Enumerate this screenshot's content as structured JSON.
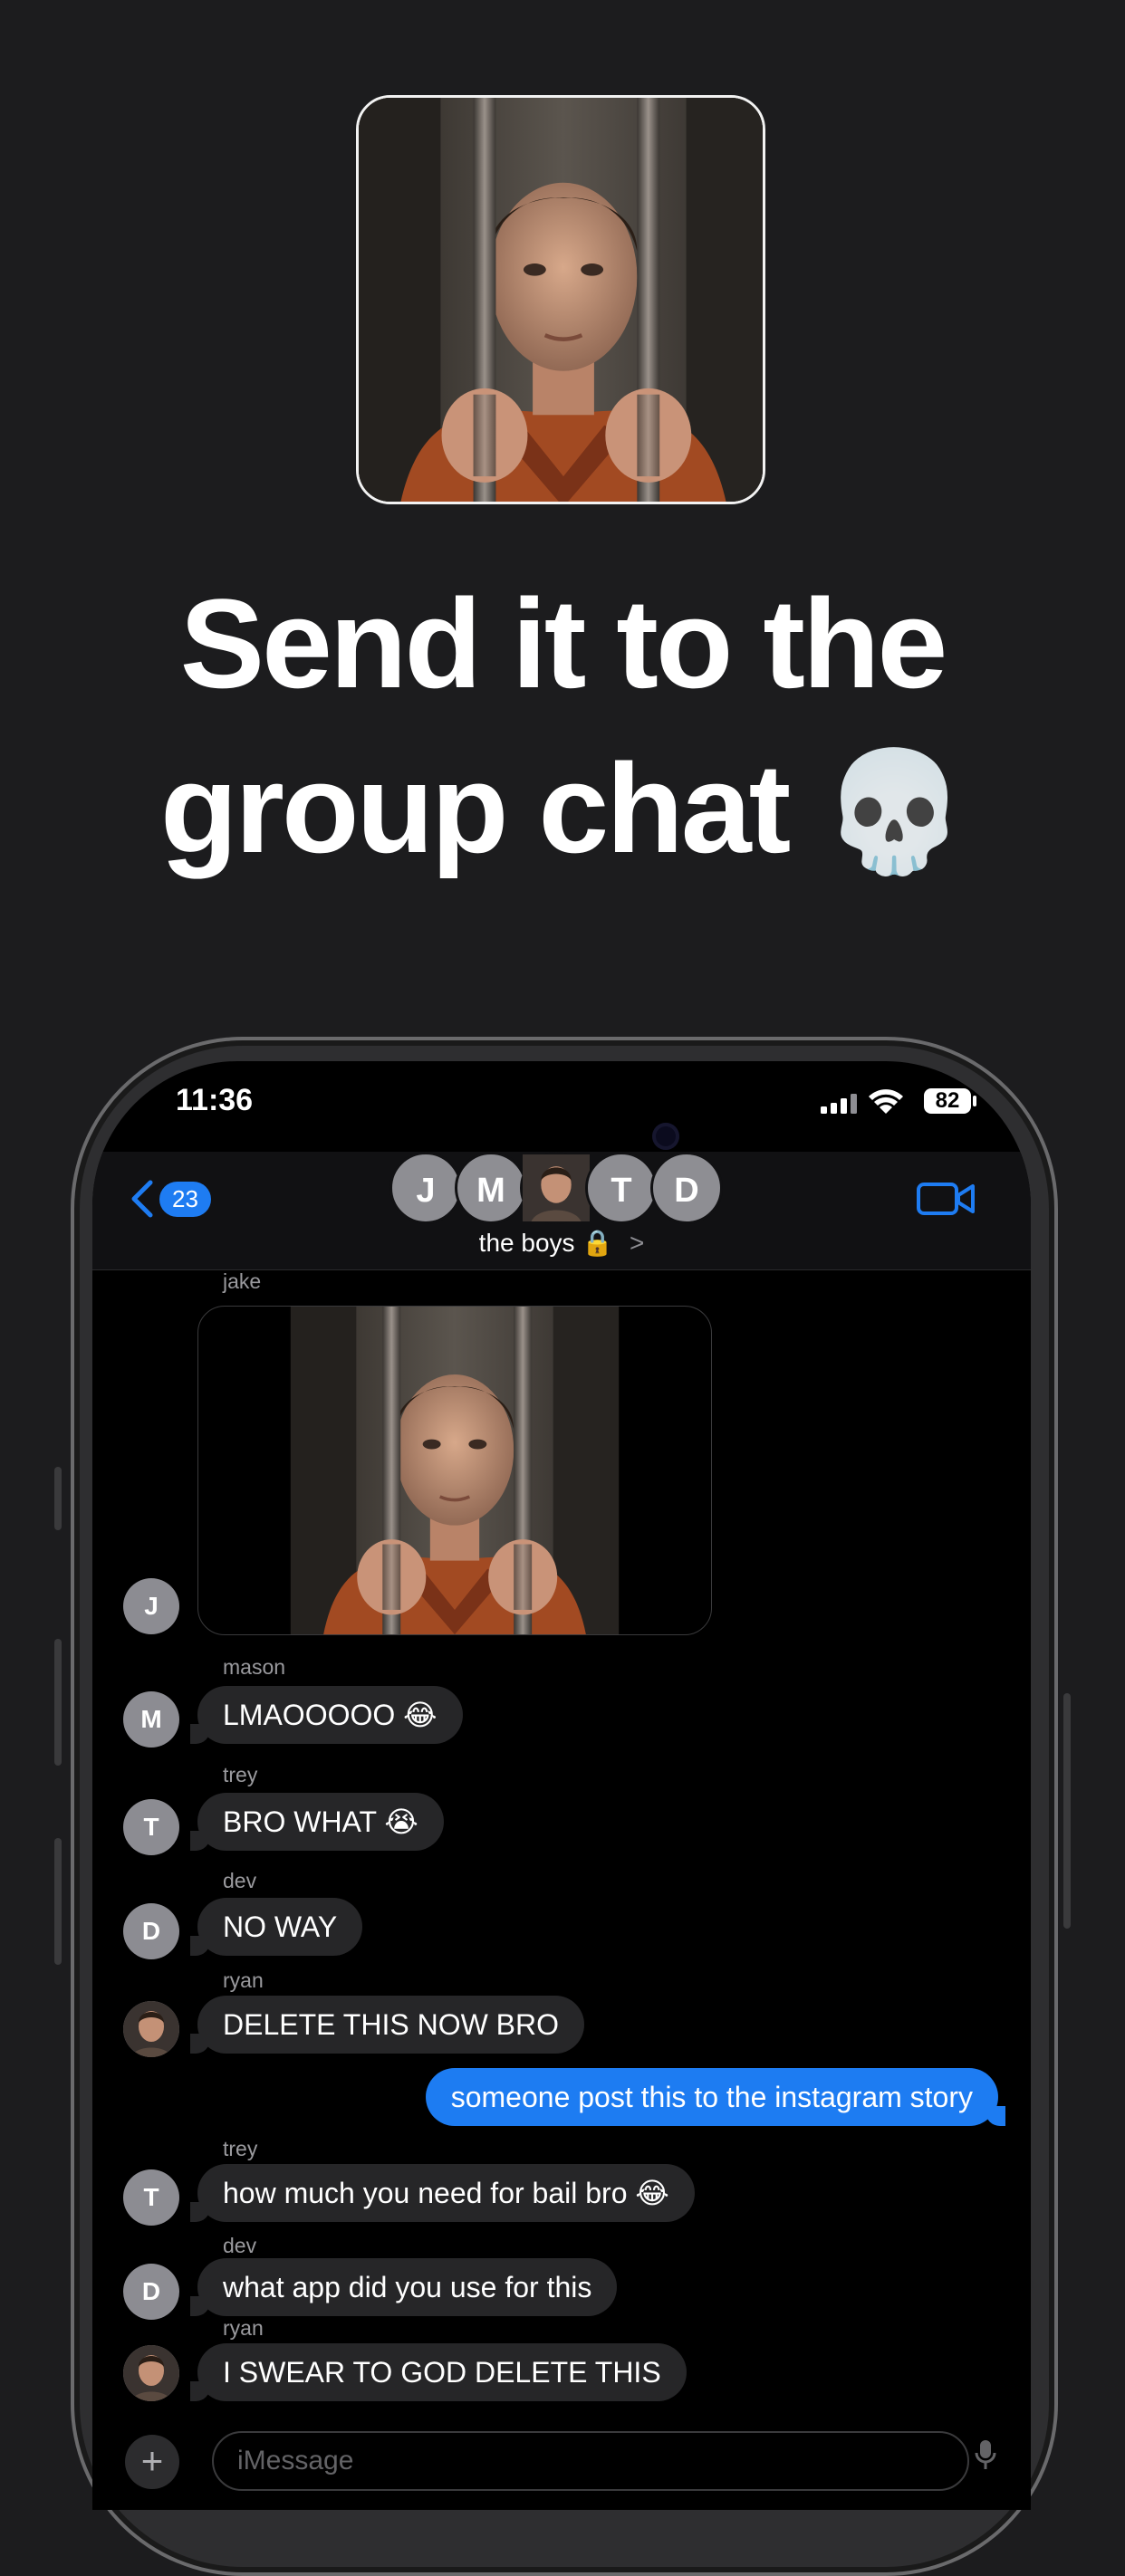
{
  "headline": {
    "line1": "Send it to the",
    "line2": "group chat",
    "emoji": "💀"
  },
  "status": {
    "time": "11:36",
    "battery": "82"
  },
  "header": {
    "back_badge": "23",
    "avatars": [
      "J",
      "M",
      "",
      "T",
      "D"
    ],
    "group_name": "the boys",
    "lock_emoji": "🔒",
    "chevron": ">"
  },
  "messages": [
    {
      "sender": "jake",
      "avatar": "J",
      "type": "photo"
    },
    {
      "sender": "mason",
      "avatar": "M",
      "text": "LMAOOOOO",
      "emoji": "😂"
    },
    {
      "sender": "trey",
      "avatar": "T",
      "text": "BRO WHAT",
      "emoji": "😭"
    },
    {
      "sender": "dev",
      "avatar": "D",
      "text": "NO WAY"
    },
    {
      "sender": "ryan",
      "avatar": "",
      "text": "DELETE THIS NOW BRO"
    },
    {
      "sender": "",
      "outgoing": true,
      "text": "someone post this to the instagram story"
    },
    {
      "sender": "trey",
      "avatar": "T",
      "text": "how much you need for bail bro",
      "emoji": "😂"
    },
    {
      "sender": "dev",
      "avatar": "D",
      "text": "what app did you use for this"
    },
    {
      "sender": "ryan",
      "avatar": "",
      "text": "I SWEAR TO GOD DELETE THIS"
    }
  ],
  "input": {
    "placeholder": "iMessage",
    "plus": "+"
  },
  "colors": {
    "imessage_blue": "#1d7cf2",
    "incoming_bubble": "#262628",
    "background": "#1c1c1e"
  }
}
